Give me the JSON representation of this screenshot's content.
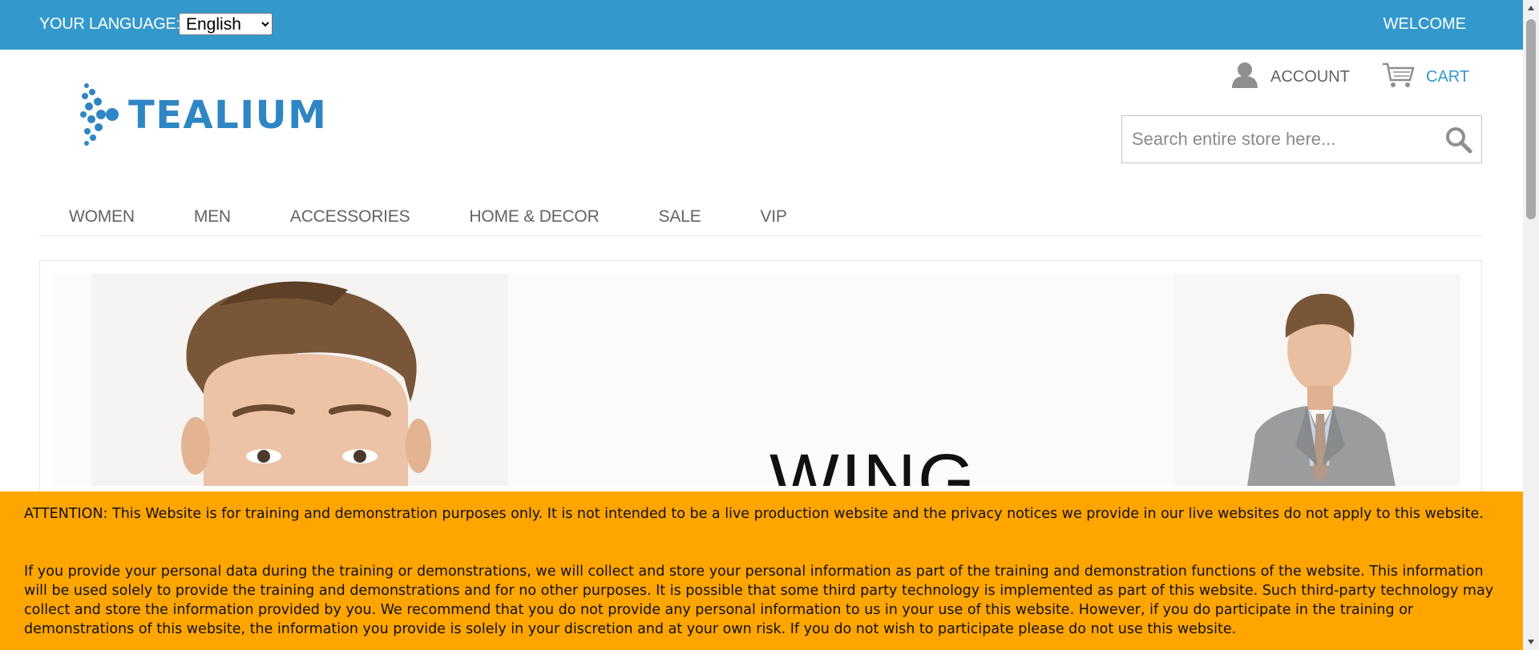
{
  "topbar": {
    "language_label": "YOUR LANGUAGE:",
    "language_selected": "English",
    "welcome": "WELCOME",
    "background": "#3399cc"
  },
  "header": {
    "logo_text": "TEALIUM",
    "account_label": "ACCOUNT",
    "account_icon": "user-icon",
    "cart_label": "CART",
    "cart_icon": "cart-icon",
    "search_placeholder": "Search entire store here...",
    "search_icon": "search-icon",
    "accent": "#3399cc"
  },
  "nav": {
    "items": [
      {
        "label": "WOMEN"
      },
      {
        "label": "MEN"
      },
      {
        "label": "ACCESSORIES"
      },
      {
        "label": "HOME & DECOR"
      },
      {
        "label": "SALE"
      },
      {
        "label": "VIP"
      }
    ]
  },
  "banner": {
    "title": "WING"
  },
  "notice": {
    "background": "#ffa500",
    "paragraph1": "ATTENTION: This Website is for training and demonstration purposes only. It is not intended to be a live production website and the privacy notices we provide in our live websites do not apply to this website.",
    "paragraph2": "If you provide your personal data during the training or demonstrations, we will collect and store your personal information as part of the training and demonstration functions of the website. This information will be used solely to provide the training and demonstrations and for no other purposes. It is possible that some third party technology is implemented as part of this website. Such third-party technology may collect and store the information provided by you. We recommend that you do not provide any personal information to us in your use of this website. However, if you do participate in the training or demonstrations of this website, the information you provide is solely in your discretion and at your own risk. If you do not wish to participate please do not use this website."
  }
}
